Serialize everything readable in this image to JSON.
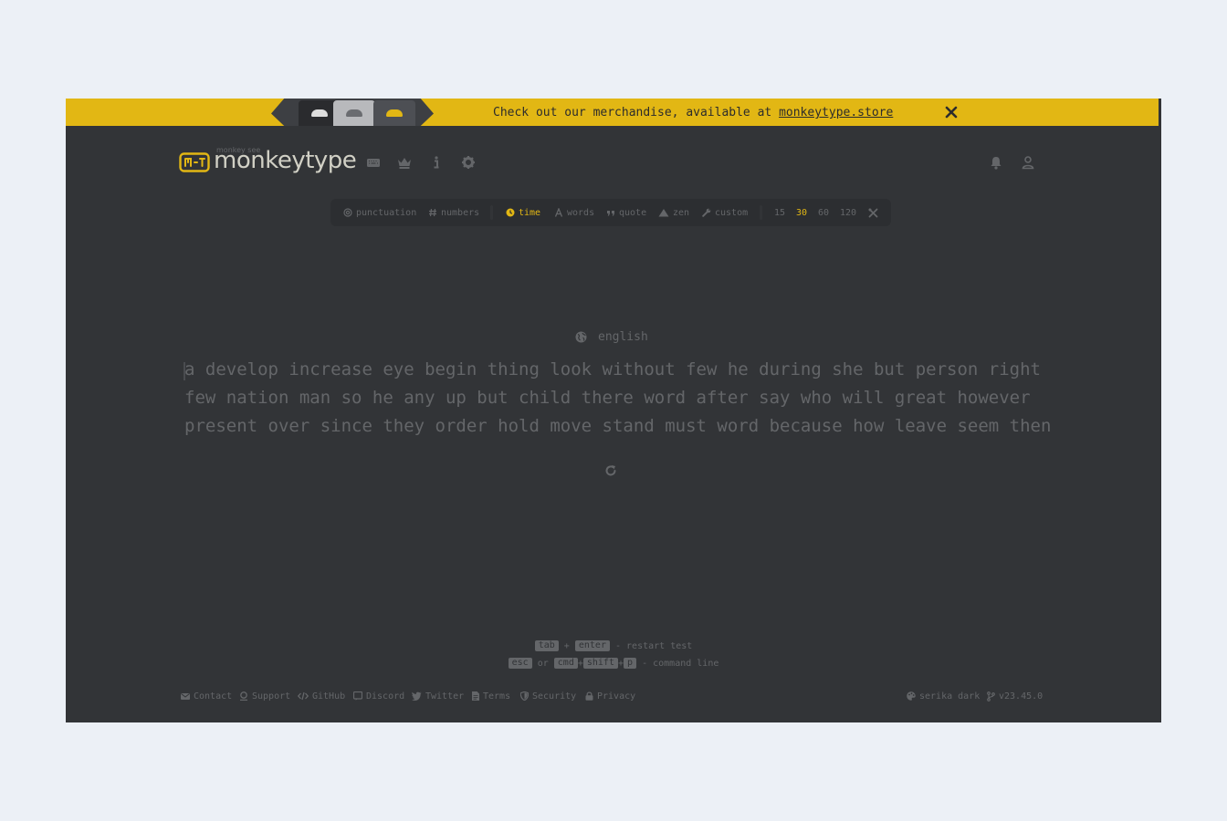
{
  "banner": {
    "text": "Check out our merchandise, available at ",
    "link": "monkeytype.store"
  },
  "header": {
    "logo_sub": "monkey see",
    "logo_text": "monkeytype"
  },
  "config": {
    "punctuation": "punctuation",
    "numbers": "numbers",
    "time": "time",
    "words": "words",
    "quote": "quote",
    "zen": "zen",
    "custom": "custom",
    "durations": [
      "15",
      "30",
      "60",
      "120"
    ],
    "selected_duration": "30"
  },
  "language": "english",
  "words": {
    "lines": [
      "a develop increase eye begin thing look without few he during she but person right",
      "few nation man so he any up but child there word after say who will great however",
      "present over since they order hold move stand must word because how leave seem then"
    ]
  },
  "shortcuts": {
    "row1": {
      "key1": "tab",
      "plus": "+",
      "key2": "enter",
      "desc": "- restart test"
    },
    "row2": {
      "key1": "esc",
      "or": "or",
      "key2": "cmd",
      "plus1": "+",
      "key3": "shift",
      "plus2": "+",
      "key4": "p",
      "desc": "- command line"
    }
  },
  "footer": {
    "contact": "Contact",
    "support": "Support",
    "github": "GitHub",
    "discord": "Discord",
    "twitter": "Twitter",
    "terms": "Terms",
    "security": "Security",
    "privacy": "Privacy",
    "theme": "serika dark",
    "version": "v23.45.0"
  },
  "colors": {
    "bg": "#323437",
    "accent": "#e2b714",
    "sub": "#646669",
    "text": "#d1d0c5",
    "sub_alt": "#2c2e31"
  }
}
